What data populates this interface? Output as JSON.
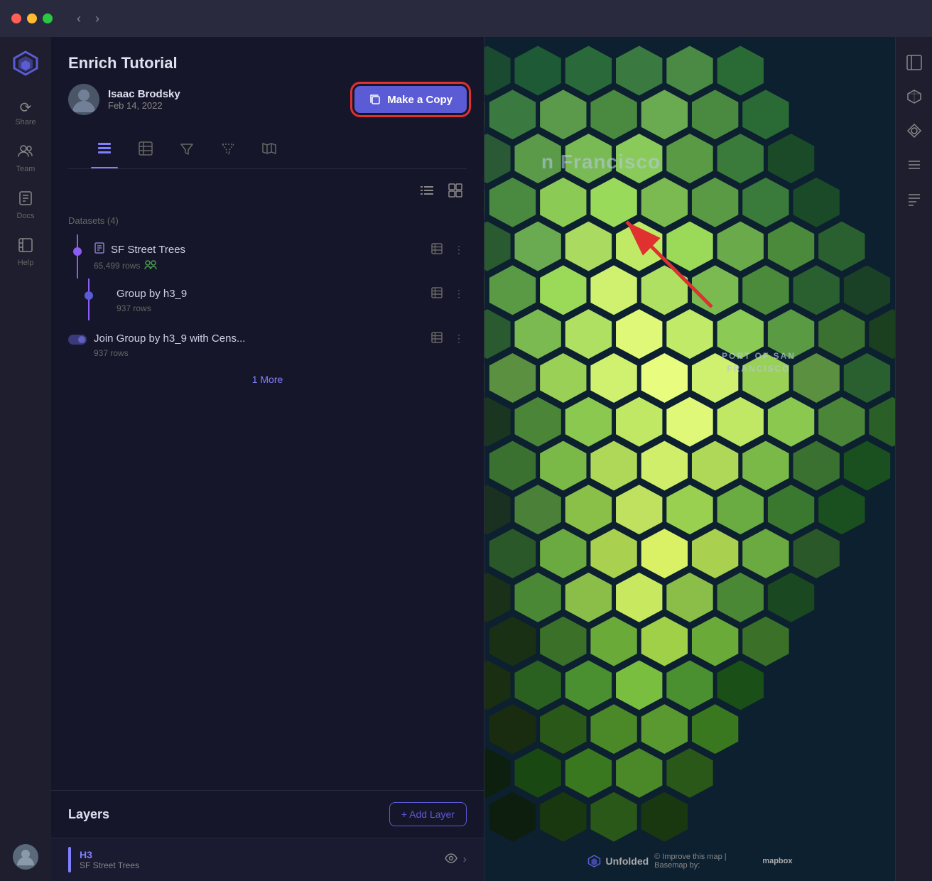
{
  "titlebar": {
    "nav_back": "‹",
    "nav_forward": "›"
  },
  "sidebar": {
    "share_label": "Share",
    "team_label": "Team",
    "docs_label": "Docs",
    "help_label": "Help"
  },
  "panel": {
    "project_title": "Enrich Tutorial",
    "author_name": "Isaac Brodsky",
    "author_date": "Feb 14, 2022",
    "make_copy_label": "Make a Copy",
    "tabs": [
      {
        "id": "layers",
        "icon": "⊞",
        "label": "Layers",
        "active": true
      },
      {
        "id": "table",
        "icon": "▦",
        "label": "Table",
        "active": false
      },
      {
        "id": "filter",
        "icon": "⊽",
        "label": "Filter",
        "active": false
      },
      {
        "id": "filter2",
        "icon": "⊿",
        "label": "Filter2",
        "active": false
      },
      {
        "id": "map",
        "icon": "⊠",
        "label": "Map",
        "active": false
      }
    ],
    "datasets_label": "Datasets (4)",
    "datasets": [
      {
        "name": "SF Street Trees",
        "rows": "65,499 rows",
        "shared": true,
        "indent": 0
      },
      {
        "name": "Group by h3_9",
        "rows": "937 rows",
        "shared": false,
        "indent": 1
      },
      {
        "name": "Join Group by h3_9 with Cens...",
        "rows": "937 rows",
        "shared": false,
        "indent": 1
      }
    ],
    "more_link": "1 More",
    "layers_title": "Layers",
    "add_layer_label": "+ Add Layer",
    "layer": {
      "name": "H3",
      "sub": "SF Street Trees",
      "color": "#8080ff"
    }
  },
  "map": {
    "city_label": "n Francisco",
    "port_label": "PORT OF SAN\nFRANCISCO",
    "watermark": "Unfolded",
    "basemap_credit": "© Improve this map | Basemap by:",
    "mapbox_credit": "mapbox"
  },
  "right_toolbar": {
    "tools": [
      {
        "id": "sidebar-toggle",
        "icon": "⊟"
      },
      {
        "id": "cube",
        "icon": "⬡"
      },
      {
        "id": "shapes",
        "icon": "◈"
      },
      {
        "id": "list",
        "icon": "≡"
      },
      {
        "id": "list2",
        "icon": "⊨"
      }
    ]
  },
  "annotation": {
    "arrow_visible": true
  }
}
